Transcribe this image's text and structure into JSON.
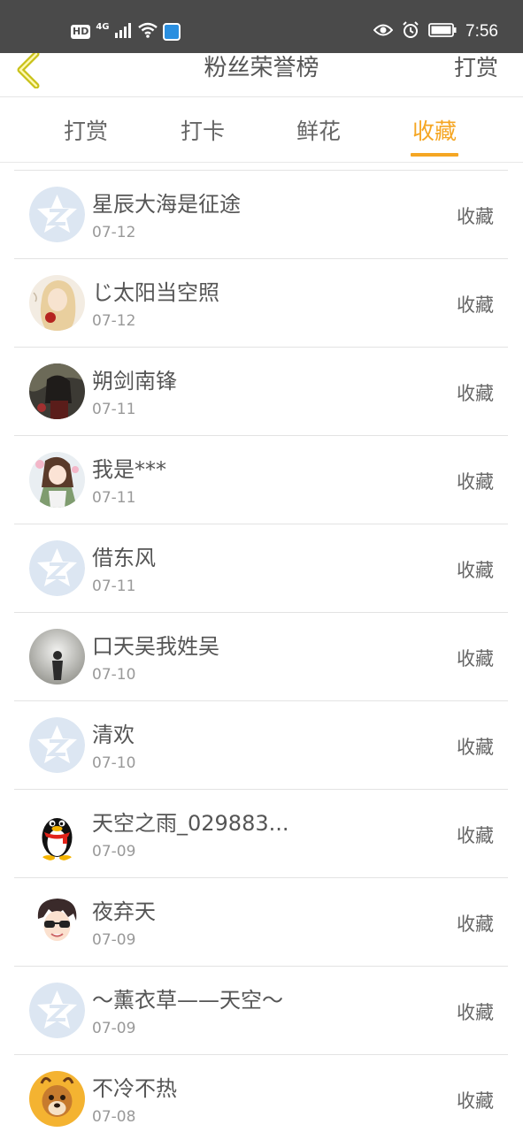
{
  "status_bar": {
    "hd": "HD",
    "network": "4G",
    "time": "7:56",
    "icons": [
      "signal-icon",
      "wifi-icon",
      "app-notification-icon",
      "eye-icon",
      "alarm-icon",
      "battery-icon"
    ]
  },
  "header": {
    "title": "粉丝荣誉榜",
    "action": "打赏",
    "back_icon": "chevron-left-icon"
  },
  "tabs": [
    {
      "label": "打赏",
      "active": false
    },
    {
      "label": "打卡",
      "active": false
    },
    {
      "label": "鲜花",
      "active": false
    },
    {
      "label": "收藏",
      "active": true
    }
  ],
  "colors": {
    "accent": "#f5a623",
    "statusbar": "#4a4a4a",
    "text": "#555555",
    "subtext": "#999999",
    "divider": "#e3e3e3"
  },
  "list": [
    {
      "name": "星辰大海是征途",
      "date": "07-12",
      "action": "收藏",
      "avatar": "default-qzone-avatar"
    },
    {
      "name": "じ太阳当空照",
      "date": "07-12",
      "action": "收藏",
      "avatar": "girl-photo-avatar"
    },
    {
      "name": "朔剑南锋",
      "date": "07-11",
      "action": "收藏",
      "avatar": "dark-anime-avatar"
    },
    {
      "name": "我是***",
      "date": "07-11",
      "action": "收藏",
      "avatar": "anime-girl-avatar"
    },
    {
      "name": "借东风",
      "date": "07-11",
      "action": "收藏",
      "avatar": "default-qzone-avatar"
    },
    {
      "name": "口天吴我姓吴",
      "date": "07-10",
      "action": "收藏",
      "avatar": "silhouette-photo-avatar"
    },
    {
      "name": "清欢",
      "date": "07-10",
      "action": "收藏",
      "avatar": "default-qzone-avatar"
    },
    {
      "name": "天空之雨_029883...",
      "date": "07-09",
      "action": "收藏",
      "avatar": "qq-penguin-avatar"
    },
    {
      "name": "夜弃天",
      "date": "07-09",
      "action": "收藏",
      "avatar": "cartoon-boy-avatar"
    },
    {
      "name": "～薰衣草——天空～",
      "date": "07-09",
      "action": "收藏",
      "avatar": "default-qzone-avatar"
    },
    {
      "name": "不冷不热",
      "date": "07-08",
      "action": "收藏",
      "avatar": "deer-cartoon-avatar"
    }
  ]
}
